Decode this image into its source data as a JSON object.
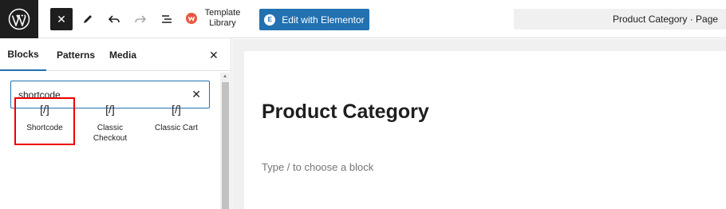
{
  "topbar": {
    "close_icon": "close-icon",
    "tools_icon": "pen-icon",
    "undo_icon": "undo-icon",
    "redo_icon": "redo-icon",
    "list_view_icon": "list-view-icon",
    "template_library_label": "Template Library",
    "elementor_button_label": "Edit with Elementor",
    "document_title": "Product Category · Page"
  },
  "sidebar": {
    "tabs": [
      {
        "label": "Blocks"
      },
      {
        "label": "Patterns"
      },
      {
        "label": "Media"
      }
    ],
    "active_tab": "Blocks",
    "search": {
      "value": "shortcode"
    },
    "results": [
      {
        "icon": "[/]",
        "label": "Shortcode",
        "highlighted": true
      },
      {
        "icon": "[/]",
        "label": "Classic Checkout"
      },
      {
        "icon": "[/]",
        "label": "Classic Cart"
      }
    ]
  },
  "editor": {
    "title": "Product Category",
    "block_placeholder": "Type / to choose a block"
  },
  "colors": {
    "accent": "#2271b1",
    "highlight_border": "#e00000",
    "dark": "#1e1e1e"
  }
}
